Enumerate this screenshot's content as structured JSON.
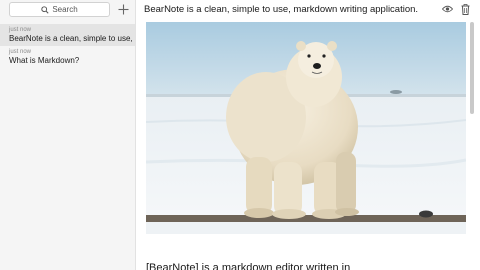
{
  "sidebar": {
    "search": {
      "placeholder": "Search",
      "icon": "search-icon"
    },
    "add_icon": "plus-icon",
    "notes": [
      {
        "time": "just now",
        "title": "BearNote is a clean, simple to use, n",
        "selected": true
      },
      {
        "time": "just now",
        "title": "What is Markdown?",
        "selected": false
      }
    ]
  },
  "editor": {
    "title": "BearNote is a clean, simple to use, markdown writing application.",
    "toolbar": {
      "preview_icon": "eye-icon",
      "delete_icon": "trash-icon"
    },
    "image_subject": "polar-bear-photo",
    "next_heading": "[BearNote] is a markdown editor written in"
  },
  "colors": {
    "sidebar_bg": "#f5f5f5",
    "selected_bg": "#e4e4e4",
    "text": "#1a1a1a",
    "muted": "#8a8a8a"
  }
}
